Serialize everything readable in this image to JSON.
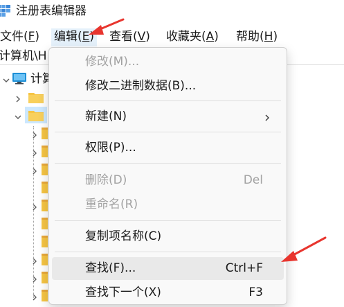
{
  "window": {
    "title": "注册表编辑器",
    "icon": "regedit-icon"
  },
  "menubar": {
    "file": {
      "pre": "文件(",
      "key": "F",
      "post": ")"
    },
    "edit": {
      "pre": "编辑(",
      "key": "E",
      "post": ")"
    },
    "view": {
      "pre": "查看(",
      "key": "V",
      "post": ")"
    },
    "favorites": {
      "pre": "收藏夹(",
      "key": "A",
      "post": ")"
    },
    "help": {
      "pre": "帮助(",
      "key": "H",
      "post": ")"
    }
  },
  "address": {
    "text": "计算机\\H"
  },
  "tree": {
    "root_label": "计算"
  },
  "context_menu": {
    "items": [
      {
        "label": "修改(M)...",
        "shortcut": "",
        "disabled": true
      },
      {
        "label": "修改二进制数据(B)...",
        "shortcut": "",
        "disabled": false
      },
      {
        "label": "新建(N)",
        "shortcut": "",
        "disabled": false,
        "submenu": true
      },
      {
        "label": "权限(P)...",
        "shortcut": "",
        "disabled": false
      },
      {
        "label": "删除(D)",
        "shortcut": "Del",
        "disabled": true
      },
      {
        "label": "重命名(R)",
        "shortcut": "",
        "disabled": true
      },
      {
        "label": "复制项名称(C)",
        "shortcut": "",
        "disabled": false
      },
      {
        "label": "查找(F)...",
        "shortcut": "Ctrl+F",
        "disabled": false,
        "hovered": true
      },
      {
        "label": "查找下一个(X)",
        "shortcut": "F3",
        "disabled": false
      }
    ]
  },
  "colors": {
    "annotation_arrow": "#e8352e",
    "folder": "#f6c544",
    "selection": "#cce8ff",
    "hover": "#e9e9e9",
    "disabled_text": "#a2a2a2"
  }
}
